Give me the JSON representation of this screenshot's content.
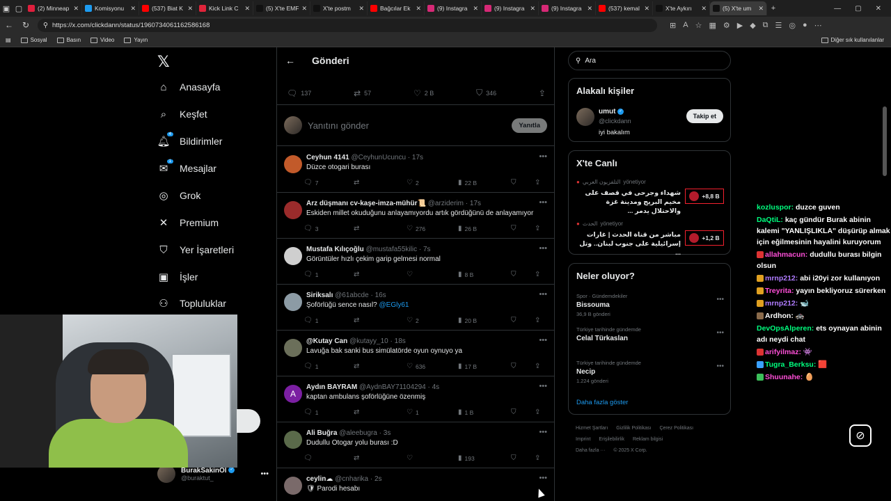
{
  "browser": {
    "tabs": [
      {
        "label": "(2) Minneap",
        "color": "#e01f3d"
      },
      {
        "label": "Komisyonu",
        "color": "#1d9bf0"
      },
      {
        "label": "(537) Biat K",
        "color": "#ff0000"
      },
      {
        "label": "Kick Link C",
        "color": "#e0243a"
      },
      {
        "label": "(5) X'te EMF",
        "color": "#111111"
      },
      {
        "label": "X'te postm",
        "color": "#111111"
      },
      {
        "label": "Bağcılar Ek",
        "color": "#ff0000"
      },
      {
        "label": "(9) Instagra",
        "color": "#d62976"
      },
      {
        "label": "(9) Instagra",
        "color": "#d62976"
      },
      {
        "label": "(9) Instagra",
        "color": "#d62976"
      },
      {
        "label": "(537) kemal",
        "color": "#ff0000"
      },
      {
        "label": "X'te Aykırı",
        "color": "#111111"
      },
      {
        "label": "(5) X'te um",
        "color": "#111111"
      }
    ],
    "url": "https://x.com/clickdann/status/1960734061162586168",
    "bookmarks": [
      "Sosyal",
      "Basın",
      "Video",
      "Yayın"
    ],
    "bookmarks_other": "Diğer sık kullanılanlar"
  },
  "nav": {
    "items": [
      {
        "label": "Anasayfa",
        "icon": "⌂"
      },
      {
        "label": "Keşfet",
        "icon": "⌕"
      },
      {
        "label": "Bildirimler",
        "icon": "🔔︎",
        "badge": "4"
      },
      {
        "label": "Mesajlar",
        "icon": "✉",
        "badge": "1"
      },
      {
        "label": "Grok",
        "icon": "◎"
      },
      {
        "label": "Premium",
        "icon": "✕"
      },
      {
        "label": "Yer İşaretleri",
        "icon": "⛉"
      },
      {
        "label": "İşler",
        "icon": "▣"
      },
      {
        "label": "Topluluklar",
        "icon": "⚇"
      },
      {
        "label": "şlar",
        "icon": ""
      }
    ],
    "user": {
      "name": "BurakSakinOl",
      "handle": "@buraktut_"
    }
  },
  "main": {
    "title": "Gönderi",
    "faded_text": "...",
    "post_actions": {
      "replies": "137",
      "reposts": "57",
      "likes": "2 B",
      "bookmarks": "346"
    },
    "reply_placeholder": "Yanıtını gönder",
    "reply_button": "Yanıtla",
    "tweets": [
      {
        "name": "Ceyhun 4141",
        "handle": "@CeyhunUcuncu",
        "time": "17s",
        "text": "Düzce otogari burası",
        "replies": "7",
        "reposts": "",
        "likes": "2",
        "views": "22 B",
        "avatar": "#c25a2a"
      },
      {
        "name": "Arz düşmanı cv-kaşe-imza-mühür📜",
        "handle": "@arziderim",
        "time": "17s",
        "text": "Eskiden millet  okuduğunu anlayamıyordu artık gördüğünü de anlayamıyor",
        "replies": "3",
        "reposts": "",
        "likes": "276",
        "views": "26 B",
        "avatar": "#9a2b2b"
      },
      {
        "name": "Mustafa Kılıçoğlu",
        "handle": "@mustafa55kilic",
        "time": "7s",
        "text": "Görüntüler hızlı çekim garip gelmesi normal",
        "replies": "1",
        "reposts": "",
        "likes": "",
        "views": "8 B",
        "avatar": "#cfcfcf"
      },
      {
        "name": "Siriksalı",
        "handle": "@61abcde",
        "time": "16s",
        "text": "Şoförlüğü sence nasıl?",
        "mention": "@EGly61",
        "replies": "1",
        "reposts": "",
        "likes": "2",
        "views": "20 B",
        "avatar": "#8c9ba5"
      },
      {
        "name": "@Kutay Can",
        "handle": "@kutayy_10",
        "time": "18s",
        "text": "Lavuğa bak sanki bus simülatörde oyun oynuyo ya",
        "replies": "1",
        "reposts": "",
        "likes": "636",
        "views": "17 B",
        "avatar": "#6b6f5a"
      },
      {
        "name": "Aydın BAYRAM",
        "handle": "@AydnBAY71104294",
        "time": "4s",
        "text": "kaptan ambulans şoförlüğüne özenmiş",
        "replies": "1",
        "reposts": "",
        "likes": "1",
        "views": "1 B",
        "avatar": "#7b1fa2",
        "initial": "A"
      },
      {
        "name": "Ali Buğra",
        "handle": "@aleebugra",
        "time": "3s",
        "text": "Dudullu Otogar yolu burası :D",
        "replies": "",
        "reposts": "",
        "likes": "",
        "views": "193",
        "avatar": "#5a6a4a"
      },
      {
        "name": "ceylin☁",
        "handle": "@cnharika",
        "time": "2s",
        "text": "🛡 Parodi hesabı",
        "replies": "",
        "reposts": "",
        "likes": "",
        "views": "",
        "avatar": "#7a6a6a"
      }
    ]
  },
  "right": {
    "search_placeholder": "Ara",
    "related": {
      "title": "Alakalı kişiler",
      "name": "umut",
      "handle": "@clickdann",
      "bio": "iyi bakalım",
      "follow": "Takip et"
    },
    "live": {
      "title": "X'te Canlı",
      "items": [
        {
          "source": "التلفزيون العربي",
          "status": "yönetiyor",
          "text": "شهداء وجرحى في قصف على مخيم البريج ومدينة غزة والاحتلال يدمر ...",
          "count": "+8,8 B"
        },
        {
          "source": "الحدث",
          "status": "yönetiyor",
          "text": "مباشر من قناة الحدث | غارات إسرائيلية على جنوب لبنان.. وتل ...",
          "count": "+1,2 B"
        }
      ]
    },
    "trends": {
      "title": "Neler oluyor?",
      "items": [
        {
          "category": "Spor · Gündemdekiler",
          "name": "Bissouma",
          "count": "36,9 B gönderi"
        },
        {
          "category": "Türkiye tarihinde gündemde",
          "name": "Celal Türkaslan",
          "count": ""
        },
        {
          "category": "Türkiye tarihinde gündemde",
          "name": "Necip",
          "count": "1.224 gönderi"
        }
      ],
      "show_more": "Daha fazla göster"
    },
    "footer": {
      "line1": [
        "Hizmet Şartları",
        "Gizlilik Politikası",
        "Çerez Politikası"
      ],
      "line2": [
        "Imprint",
        "Erişilebilirlik",
        "Reklam bilgisi"
      ],
      "line3": [
        "Daha fazla ···",
        "© 2025 X Corp."
      ]
    }
  },
  "chat": [
    {
      "user": "kozluspor:",
      "text": "duzce guven",
      "cls": "u1"
    },
    {
      "user": "DaQtiL:",
      "text": "kaç gündür Burak abinin kalemi \"YANLIŞLIKLA\" düşürüp almak için eğilmesinin hayalini kuruyorum",
      "cls": "u1"
    },
    {
      "user": "allahmacun:",
      "text": "dudullu burası bilgin olsun",
      "cls": "u2",
      "badge": "r"
    },
    {
      "user": "mrnp212:",
      "text": "abi i20yi zor kullanıyon",
      "cls": "u3",
      "badge": "g"
    },
    {
      "user": "Treyrita:",
      "text": "yayın bekliyoruz sürerken",
      "cls": "u2",
      "badge": "g"
    },
    {
      "user": "mrnp212:",
      "text": "🐋",
      "cls": "u3",
      "badge": "g"
    },
    {
      "user": "Ardhon:",
      "text": "🚓",
      "cls": "u5",
      "badge": "k"
    },
    {
      "user": "DevOpsAlperen:",
      "text": "ets oynayan abinin adı neydi chat",
      "cls": "u1"
    },
    {
      "user": "arifyilmaz:",
      "text": "👾",
      "cls": "u2",
      "badge": "r"
    },
    {
      "user": "Tugra_Berksu:",
      "text": "🟥",
      "cls": "u1",
      "badge": "b"
    },
    {
      "user": "Shuunahe:",
      "text": "🥚",
      "cls": "u2",
      "badge": "gr"
    }
  ]
}
